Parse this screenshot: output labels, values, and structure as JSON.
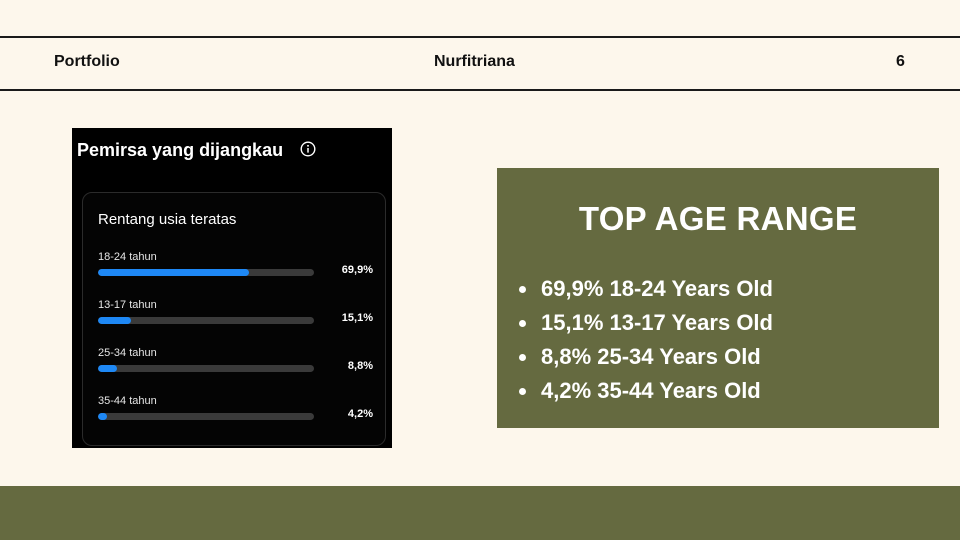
{
  "header": {
    "left": "Portfolio",
    "center": "Nurfitriana",
    "page_number": "6"
  },
  "screenshot": {
    "title": "Pemirsa yang dijangkau",
    "info_icon": "info-icon",
    "card_title": "Rentang usia teratas",
    "rows": [
      {
        "label": "18-24 tahun",
        "value": "69,9%",
        "fraction": 0.699
      },
      {
        "label": "13-17 tahun",
        "value": "15,1%",
        "fraction": 0.151
      },
      {
        "label": "25-34 tahun",
        "value": "8,8%",
        "fraction": 0.088
      },
      {
        "label": "35-44 tahun",
        "value": "4,2%",
        "fraction": 0.042
      }
    ],
    "bar_color": "#1e88f5"
  },
  "panel": {
    "title": "TOP AGE RANGE",
    "items": [
      "69,9% 18-24 Years Old",
      "15,1% 13-17 Years Old",
      "8,8% 25-34 Years Old",
      "4,2% 35-44 Years Old"
    ],
    "color": "#656a40"
  }
}
